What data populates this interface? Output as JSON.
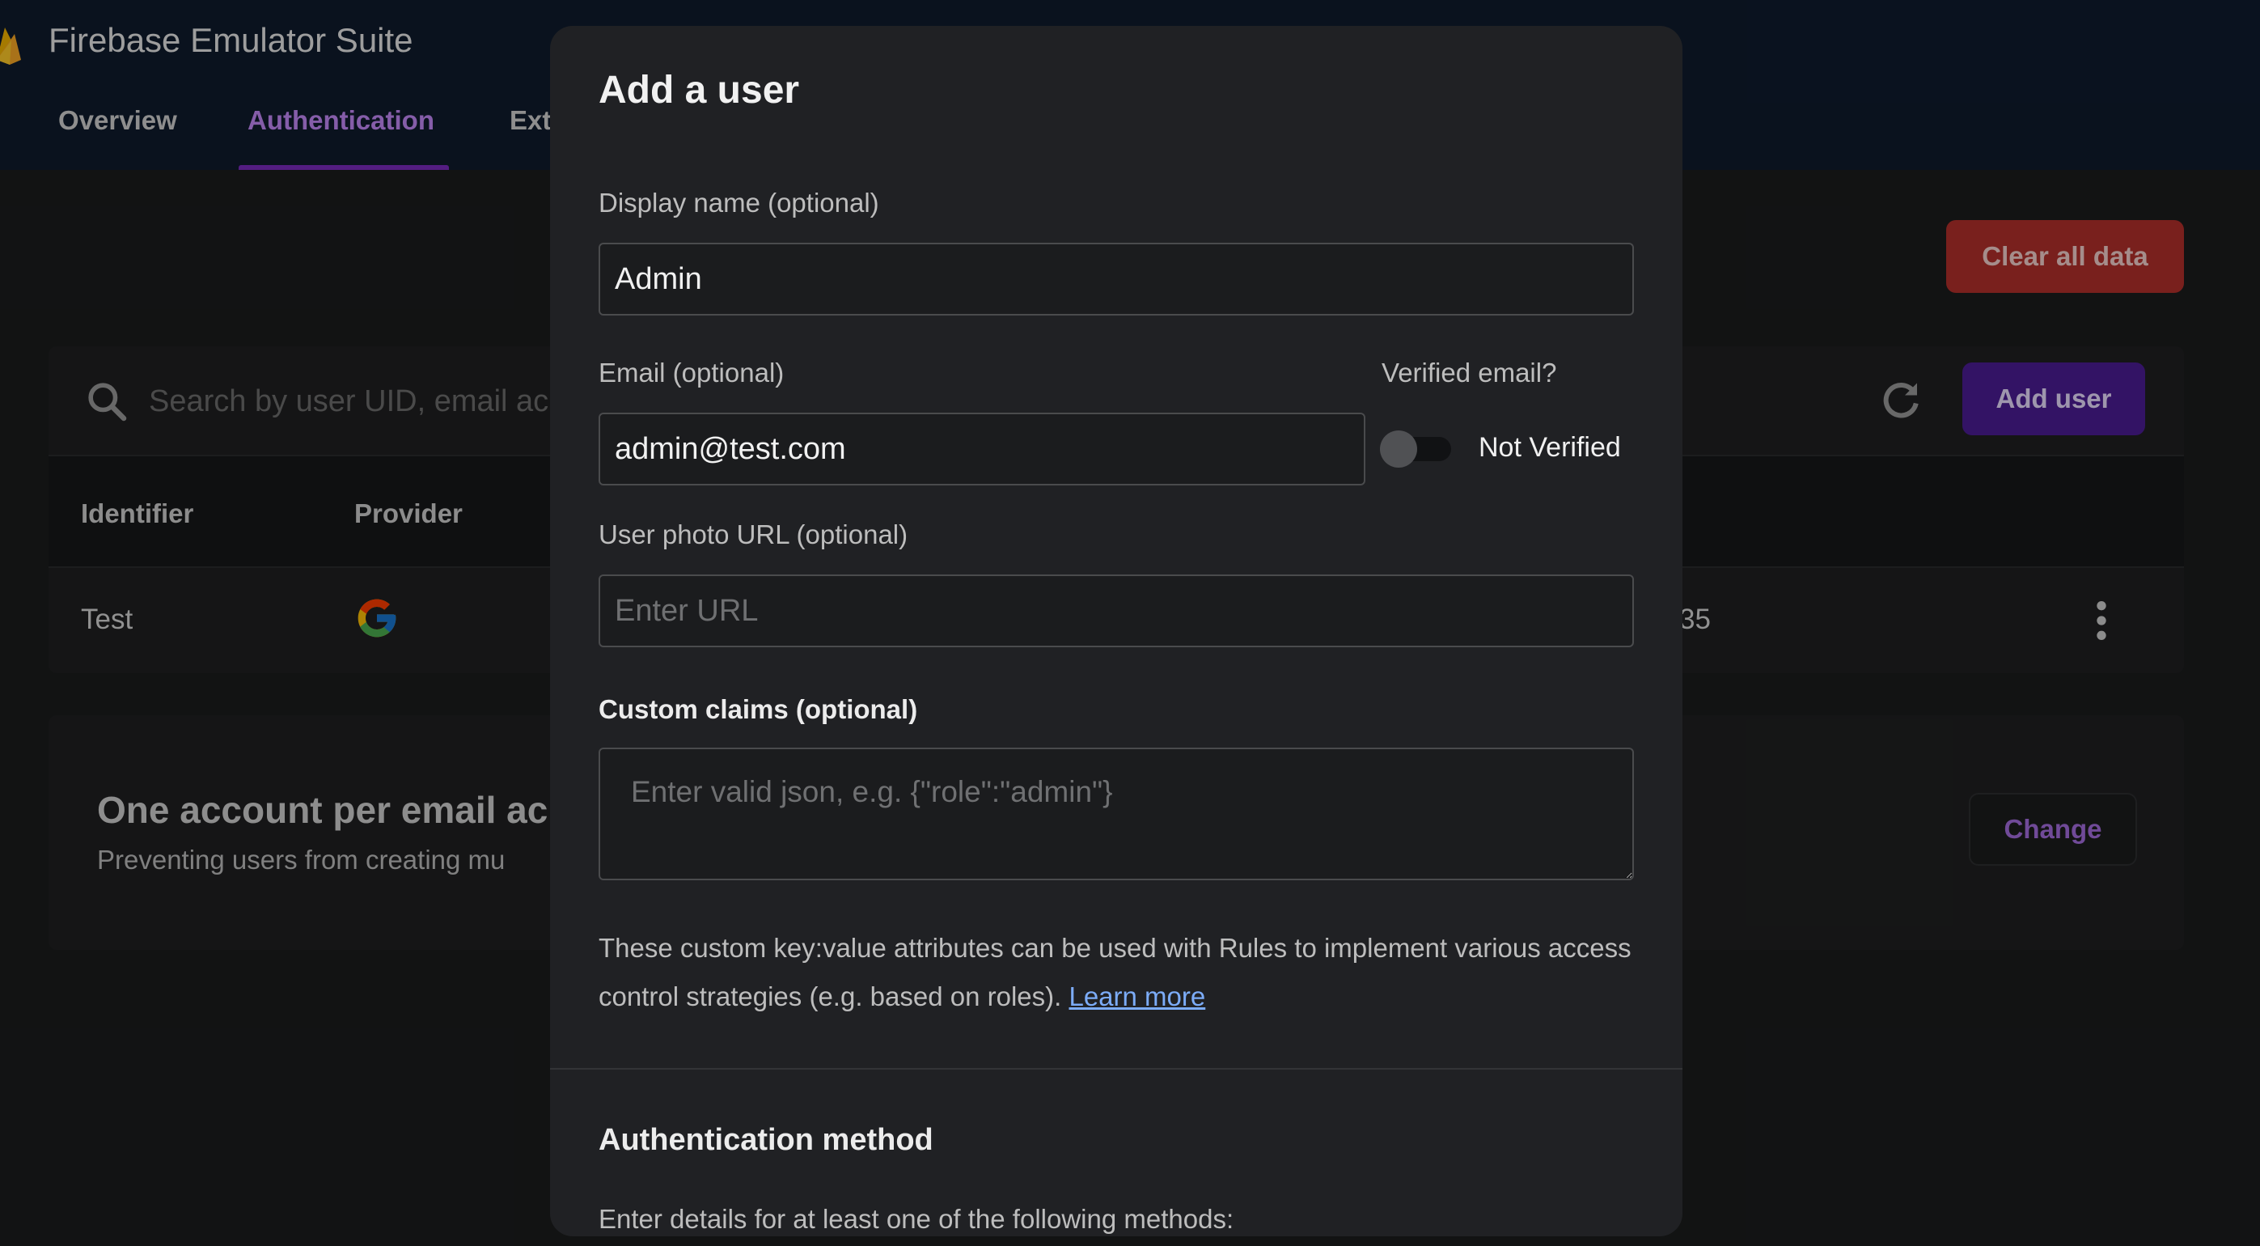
{
  "header": {
    "app_title": "Firebase Emulator Suite",
    "tabs": [
      {
        "label": "Overview"
      },
      {
        "label": "Authentication"
      },
      {
        "label": "Ext"
      }
    ]
  },
  "toolbar": {
    "clear_label": "Clear all data",
    "add_user_label": "Add user",
    "search_placeholder": "Search by user UID, email ac"
  },
  "table": {
    "headers": [
      "Identifier",
      "Provider"
    ],
    "rows": [
      {
        "identifier": "Test",
        "provider": "google-icon",
        "trailing": "35"
      }
    ]
  },
  "policy": {
    "title": "One account per email ac",
    "subtitle": "Preventing users from creating mu",
    "change_label": "Change"
  },
  "dialog": {
    "title": "Add a user",
    "display_name_label": "Display name (optional)",
    "display_name_value": "Admin",
    "email_label": "Email (optional)",
    "email_value": "admin@test.com",
    "verified_label": "Verified email?",
    "verified_status": "Not Verified",
    "photo_label": "User photo URL (optional)",
    "photo_placeholder": "Enter URL",
    "claims_label": "Custom claims (optional)",
    "claims_placeholder": "Enter valid json, e.g. {\"role\":\"admin\"}",
    "helper_text": "These custom key:value attributes can be used with Rules to implement various access control strategies (e.g. based on roles).",
    "learn_more": "Learn more",
    "auth_title": "Authentication method",
    "auth_subtitle": "Enter details for at least one of the following methods:"
  },
  "colors": {
    "accent_purple": "#7b2cbf",
    "danger_red": "#b3302c",
    "link_blue": "#7cacf8"
  }
}
